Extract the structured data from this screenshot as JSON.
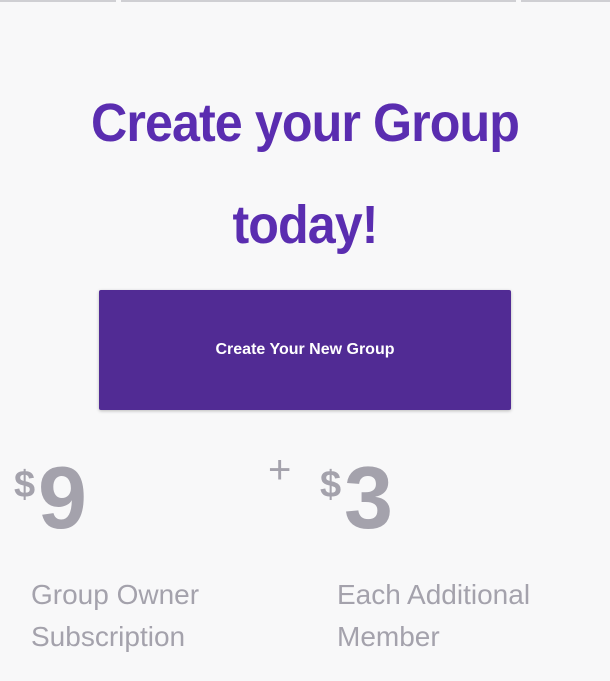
{
  "hero": {
    "headline_line1": "Create your Group",
    "headline_line2": "today!",
    "cta_label": "Create Your New Group"
  },
  "pricing": {
    "owner": {
      "currency": "$",
      "amount": "9",
      "desc_line1": "Group Owner",
      "desc_line2": "Subscription"
    },
    "operator": "+",
    "member": {
      "currency": "$",
      "amount": "3",
      "desc_line1": "Each Additional",
      "desc_line2": "Member"
    }
  },
  "colors": {
    "headline": "#5a2db0",
    "button": "#512b94",
    "muted_text": "#a4a2ac",
    "background": "#f8f8f9"
  }
}
